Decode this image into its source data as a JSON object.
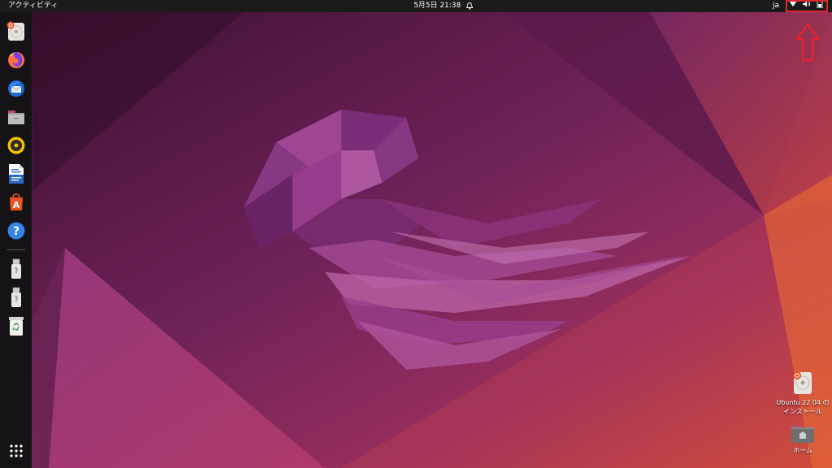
{
  "topbar": {
    "activities_label": "アクティビティ",
    "clock_label": "5月5日 21:38",
    "input_method": "ja",
    "tray_icons": [
      "wifi-icon",
      "volume-icon",
      "battery-icon"
    ]
  },
  "dock": {
    "items": [
      {
        "name": "ubuntu-installer-icon"
      },
      {
        "name": "firefox-icon"
      },
      {
        "name": "thunderbird-icon"
      },
      {
        "name": "files-icon"
      },
      {
        "name": "rhythmbox-icon"
      },
      {
        "name": "libreoffice-writer-icon"
      },
      {
        "name": "ubuntu-software-icon"
      },
      {
        "name": "help-icon"
      },
      {
        "name": "usb-drive-icon"
      },
      {
        "name": "usb-drive-icon"
      },
      {
        "name": "trash-icon"
      },
      {
        "name": "show-apps-grid-icon"
      }
    ]
  },
  "desktop": {
    "install_icon": {
      "label": "Ubuntu 22.04 の インストール"
    },
    "home_icon": {
      "label": "ホーム"
    }
  },
  "colors": {
    "topbar": "#1b1b1b",
    "dock": "#151315",
    "highlight_annotation": "#e0262f",
    "wallpaper_dark": "#3c1030",
    "wallpaper_mid": "#8a2a6a",
    "wallpaper_orange": "#d9552f"
  }
}
